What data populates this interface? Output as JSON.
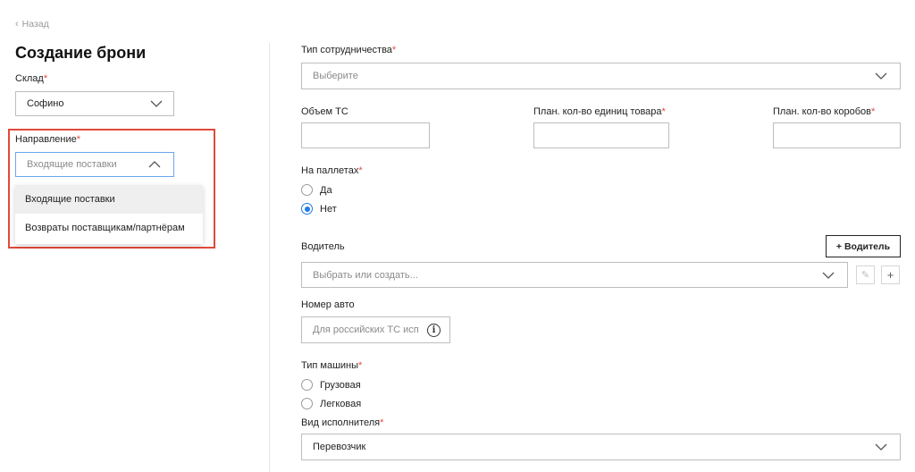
{
  "nav": {
    "back_label": "Назад"
  },
  "page": {
    "title": "Создание брони"
  },
  "left": {
    "warehouse": {
      "label": "Склад",
      "required": "*",
      "value": "Софино"
    },
    "direction": {
      "label": "Направление",
      "required": "*",
      "placeholder": "Входящие поставки",
      "expanded": true,
      "options": [
        "Входящие поставки",
        "Возвраты поставщикам/партнёрам"
      ]
    }
  },
  "form": {
    "cooperation_type": {
      "label": "Тип сотрудничества",
      "required": "*",
      "placeholder": "Выберите"
    },
    "vehicle_volume": {
      "label": "Объем ТС",
      "value": ""
    },
    "planned_units": {
      "label": "План. кол-во единиц товара",
      "required": "*",
      "value": ""
    },
    "planned_boxes": {
      "label": "План. кол-во коробов",
      "required": "*",
      "value": ""
    },
    "on_pallets": {
      "label": "На паллетах",
      "required": "*",
      "options": [
        "Да",
        "Нет"
      ],
      "selected": "Нет"
    },
    "driver": {
      "label": "Водитель",
      "add_button": "+ Водитель",
      "placeholder": "Выбрать или создать...",
      "edit_icon": "pencil-icon",
      "add_icon": "plus-icon"
    },
    "car_number": {
      "label": "Номер авто",
      "placeholder": "Для российских ТС исп",
      "info_icon": "info-icon"
    },
    "vehicle_type": {
      "label": "Тип машины",
      "required": "*",
      "options": [
        "Грузовая",
        "Легковая"
      ],
      "selected": ""
    },
    "executor_type": {
      "label": "Вид исполнителя",
      "required": "*",
      "value": "Перевозчик"
    }
  },
  "colors": {
    "required": "#e24b3b",
    "radio_checked": "#1e7ae6",
    "highlight_border": "#e04a3a"
  }
}
